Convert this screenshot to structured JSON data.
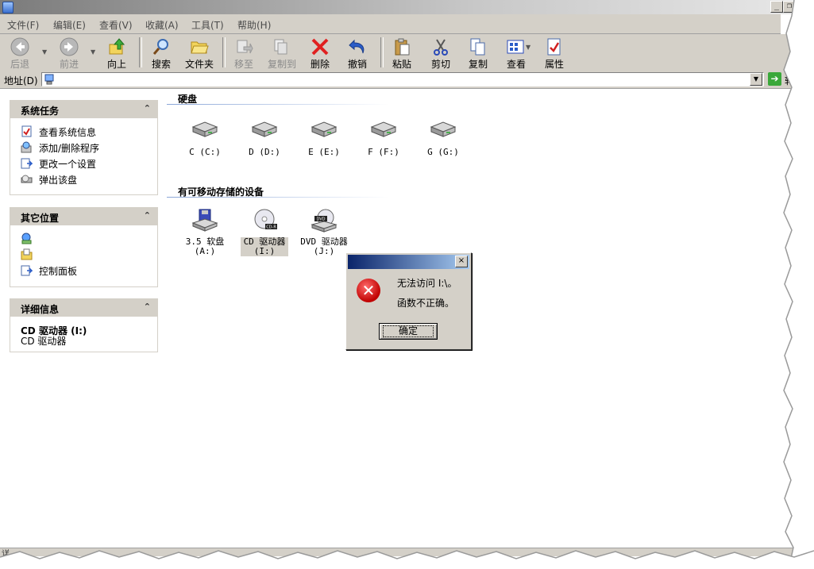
{
  "window": {
    "caption_buttons": {
      "minimize": "_",
      "restore": "❐"
    }
  },
  "menu": {
    "items": [
      "文件(F)",
      "编辑(E)",
      "查看(V)",
      "收藏(A)",
      "工具(T)",
      "帮助(H)"
    ]
  },
  "toolbar": {
    "back": "后退",
    "forward": "前进",
    "up": "向上",
    "search": "搜索",
    "folders": "文件夹",
    "move_to": "移至",
    "copy_to": "复制到",
    "delete": "删除",
    "undo": "撤销",
    "paste": "粘贴",
    "cut": "剪切",
    "copy": "复制",
    "views": "查看",
    "properties": "属性"
  },
  "address": {
    "label": "地址(D)",
    "value": "",
    "go_label": "转"
  },
  "sidebar": {
    "system_tasks": {
      "title": "系统任务",
      "items": [
        "查看系统信息",
        "添加/删除程序",
        "更改一个设置",
        "弹出该盘"
      ]
    },
    "other_places": {
      "title": "其它位置",
      "items": [
        "",
        "",
        "控制面板"
      ]
    },
    "details": {
      "title": "详细信息",
      "name": "CD 驱动器 (I:)",
      "type": "CD 驱动器"
    },
    "collapse_glyph": "⌃"
  },
  "content": {
    "hard_disks": {
      "title": "硬盘",
      "drives": [
        "C (C:)",
        "D (D:)",
        "E (E:)",
        "F (F:)",
        "G (G:)"
      ]
    },
    "removable": {
      "title": "有可移动存储的设备",
      "drives": [
        {
          "line1": "3.5 软盘",
          "line2": "(A:)",
          "icon": "floppy-icon"
        },
        {
          "line1": "CD 驱动器",
          "line2": "(I:)",
          "icon": "cd-drive-icon",
          "badge": "CD-R"
        },
        {
          "line1": "DVD 驱动器",
          "line2": "(J:)",
          "icon": "dvd-drive-icon",
          "badge": "DVD"
        }
      ]
    }
  },
  "dialog": {
    "close": "×",
    "message_line1": "无法访问 I:\\。",
    "message_line2": "函数不正确。",
    "ok": "确定"
  },
  "statusbar": {
    "text": "详"
  },
  "colors": {
    "title_blue": "#0a246a",
    "error_red": "#c00000",
    "chrome": "#d4d0c8"
  }
}
